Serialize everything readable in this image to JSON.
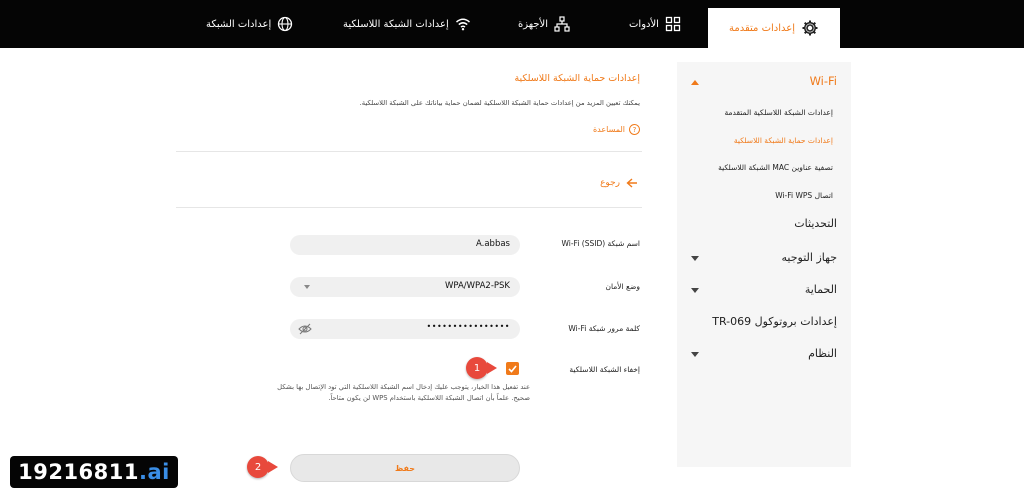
{
  "nav": {
    "tabs": [
      {
        "label": "إعدادات الشبكة",
        "icon": "globe-icon"
      },
      {
        "label": "إعدادات الشبكة اللاسلكية",
        "icon": "wifi-icon"
      },
      {
        "label": "الأجهزة",
        "icon": "devices-icon"
      },
      {
        "label": "الأدوات",
        "icon": "tools-grid-icon"
      },
      {
        "label": "إعدادات متقدمة",
        "icon": "gear-icon",
        "active": true
      }
    ]
  },
  "sidebar": {
    "wifi": "Wi-Fi",
    "wifi_items": [
      "إعدادات الشبكة اللاسلكية المتقدمة",
      "إعدادات حماية الشبكة اللاسلكية",
      "تصفية عناوين MAC الشبكة اللاسلكية",
      "اتصال Wi-Fi WPS"
    ],
    "active_item_index": 1,
    "sections": [
      "التحديثات",
      "جهاز التوجيه",
      "الحماية",
      "إعدادات بروتوكول TR-069",
      "النظام"
    ]
  },
  "page": {
    "title": "إعدادات حماية الشبكة اللاسلكية",
    "description": "يمكنك تعيين المزيد من إعدادات حماية الشبكة اللاسلكية لضمان حماية بياناتك على الشبكة اللاسلكية.",
    "help": "المساعدة",
    "back": "رجوع"
  },
  "form": {
    "ssid_label": "اسم شبكة Wi-Fi (SSID)",
    "ssid_value": "A.abbas",
    "security_label": "وضع الأمان",
    "security_value": "WPA/WPA2-PSK",
    "password_label": "كلمة مرور شبكة Wi-Fi",
    "password_value": "••••••••••••••••",
    "hide_label": "إخفاء الشبكة اللاسلكية",
    "hide_checked": true,
    "hint": "عند تفعيل هذا الخيار، يتوجب عليك إدخال اسم الشبكة اللاسلكية التي تود الإتصال بها بشكل صحيح. علماً بأن اتصال الشبكة اللاسلكية باستخدام WPS لن يكون متاحاً.",
    "save": "حفظ"
  },
  "callouts": [
    "1",
    "2"
  ],
  "watermark": {
    "main": "19216811",
    "tld": ".ai"
  },
  "colors": {
    "accent": "#f07a1a",
    "topbar": "#050505",
    "callout": "#e8493c"
  }
}
